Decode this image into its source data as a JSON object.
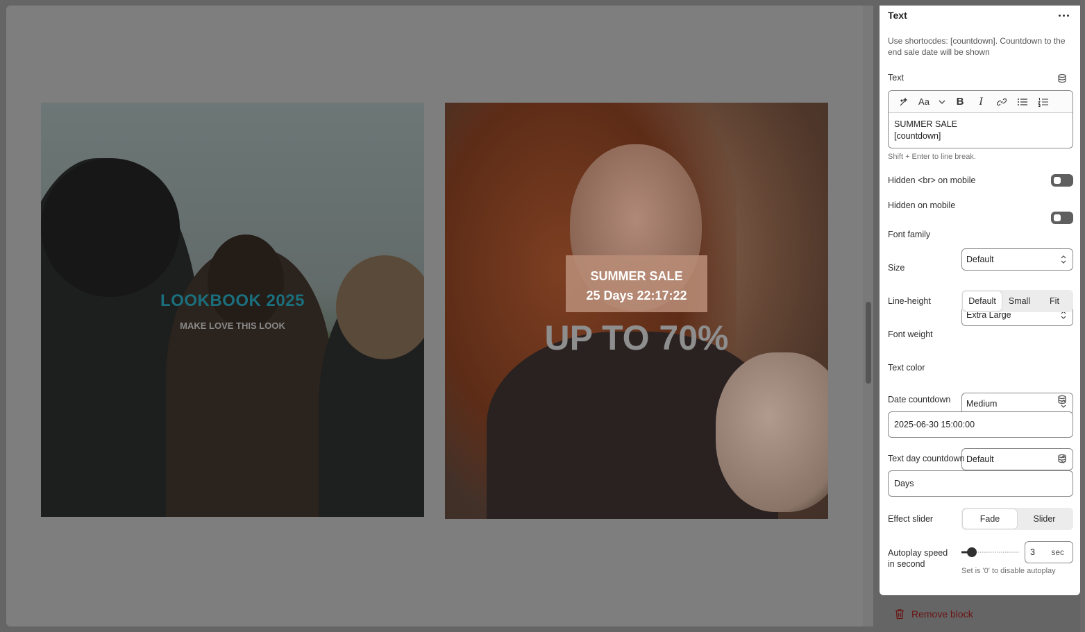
{
  "preview": {
    "card1": {
      "title": "LOOKBOOK 2025",
      "subtitle": "MAKE LOVE THIS LOOK"
    },
    "card2": {
      "sale_line1": "SUMMER SALE",
      "sale_line2": "25 Days 22:17:22",
      "headline": "UP TO 70%"
    }
  },
  "panel": {
    "title": "Text",
    "hint": "Use shortocdes: [countdown]. Countdown to the end sale date will be shown",
    "text_label": "Text",
    "editor": {
      "toolbar": [
        "magic-icon",
        "font-size-icon",
        "bold-icon",
        "italic-icon",
        "link-icon",
        "bullet-list-icon",
        "numbered-list-icon"
      ],
      "font_glyph": "Aa",
      "bold_glyph": "B",
      "italic_glyph": "I",
      "line1": "SUMMER SALE",
      "line2": "[countdown]"
    },
    "editor_hint": "Shift + Enter to line break.",
    "hidden_br_label": "Hidden <br> on mobile",
    "hidden_mobile_label": "Hidden on mobile",
    "font_family": {
      "label": "Font family",
      "value": "Default"
    },
    "size": {
      "label": "Size",
      "value": "Extra Large"
    },
    "line_height": {
      "label": "Line-height",
      "options": [
        "Default",
        "Small",
        "Fit"
      ],
      "selected": "Default"
    },
    "font_weight": {
      "label": "Font weight",
      "value": "Medium"
    },
    "text_color": {
      "label": "Text color",
      "value": "Default"
    },
    "date_countdown": {
      "label": "Date countdown",
      "value": "2025-06-30 15:00:00"
    },
    "text_day_countdown": {
      "label": "Text day countdown",
      "value": "Days"
    },
    "effect_slider": {
      "label": "Effect slider",
      "options": [
        "Fade",
        "Slider"
      ],
      "selected": "Fade"
    },
    "autoplay": {
      "label_line1": "Autoplay speed",
      "label_line2": "in second",
      "value": "3",
      "unit": "sec",
      "hint": "Set is '0' to disable autoplay",
      "slider_fraction": 0.18
    },
    "remove_label": "Remove block"
  },
  "colors": {
    "accent_title": "#1b6f7d",
    "danger": "#6b1414",
    "toggle_off": "#5f5f5f"
  }
}
